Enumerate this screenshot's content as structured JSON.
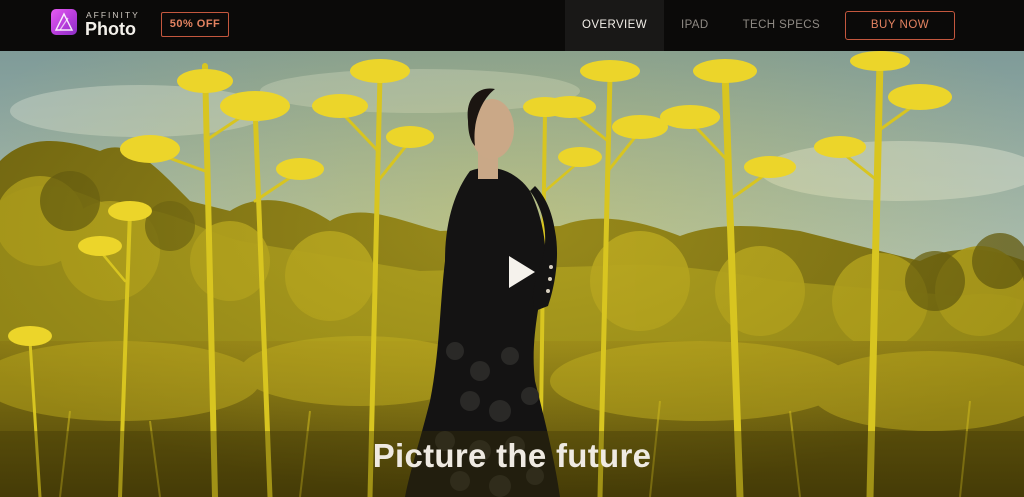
{
  "nav": {
    "logo": {
      "brand": "AFFINITY",
      "product": "Photo",
      "icon": "affinity-photo-logo-icon"
    },
    "badge": "50% OFF",
    "tabs": [
      {
        "label": "OVERVIEW",
        "active": true
      },
      {
        "label": "IPAD",
        "active": false
      },
      {
        "label": "TECH SPECS",
        "active": false
      }
    ],
    "buy_label": "BUY NOW"
  },
  "hero": {
    "headline": "Picture the future",
    "play_icon": "play-icon",
    "colors": {
      "sky": "#9db6b0",
      "foliage_yellow": "#d6c21a",
      "dress": "#141313",
      "accent": "#c4573e"
    }
  }
}
